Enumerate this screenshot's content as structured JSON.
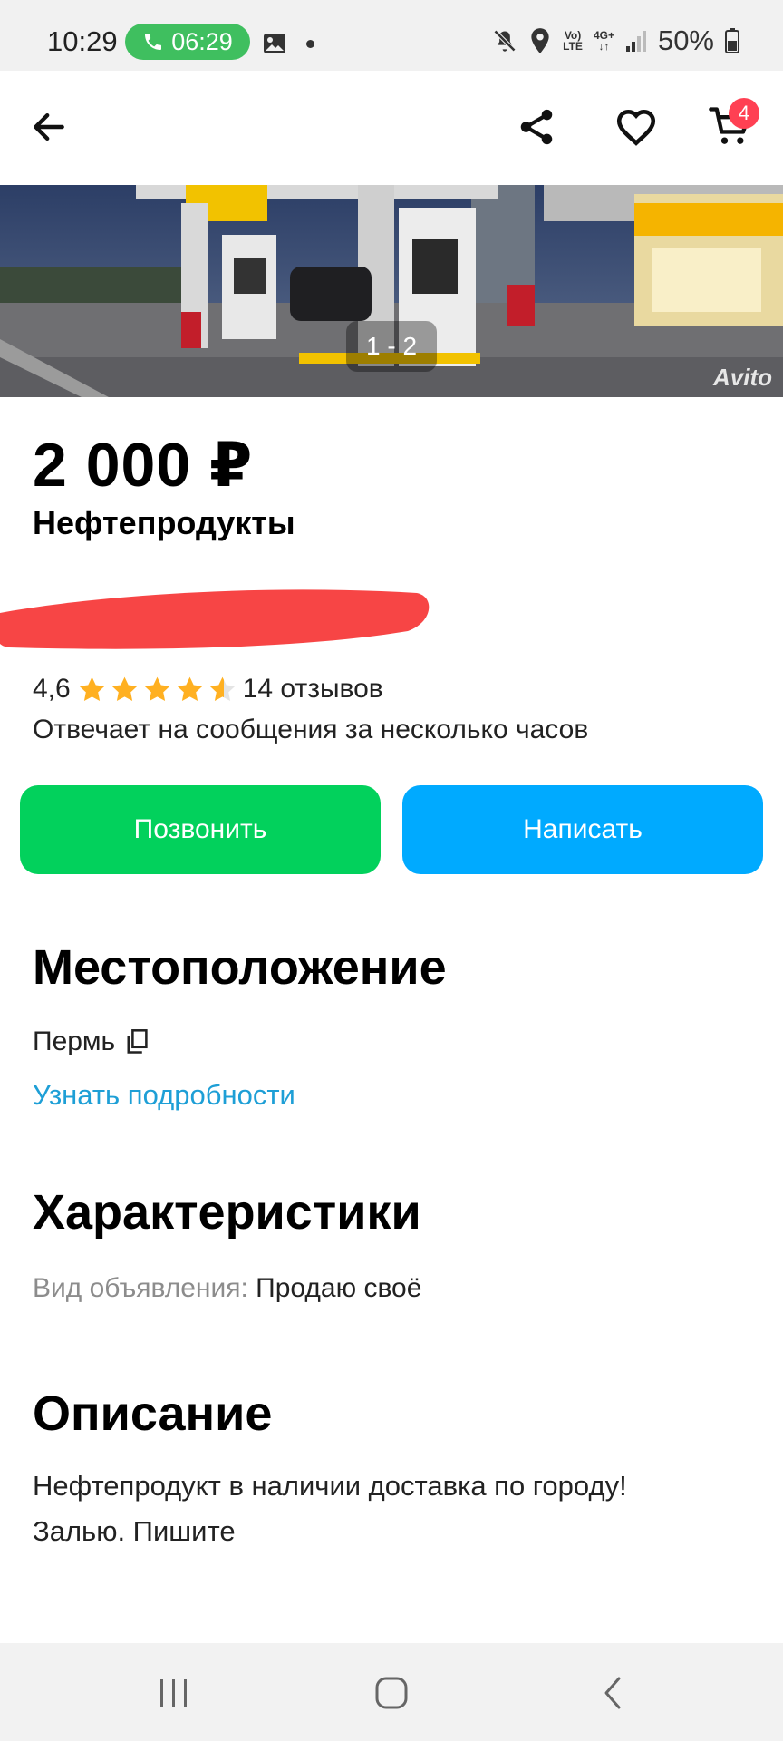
{
  "status_bar": {
    "time": "10:29",
    "call_timer": "06:29",
    "network_volte": "Vo)",
    "network_lte": "LTE",
    "network_4g": "4G+",
    "battery": "50%"
  },
  "app_bar": {
    "cart_count": "4"
  },
  "gallery": {
    "counter": "1 - 2",
    "watermark": "Avito"
  },
  "listing": {
    "price": "2 000 ₽",
    "title": "Нефтепродукты"
  },
  "seller": {
    "rating": "4,6",
    "rating_value": 4.6,
    "reviews": "14 отзывов",
    "reply_time": "Отвечает на сообщения за несколько часов"
  },
  "actions": {
    "call_label": "Позвонить",
    "write_label": "Написать"
  },
  "location": {
    "heading": "Местоположение",
    "city": "Пермь",
    "more_link": "Узнать подробности"
  },
  "characteristics": {
    "heading": "Характеристики",
    "items": [
      {
        "label": "Вид объявления: ",
        "value": "Продаю своё"
      }
    ]
  },
  "description": {
    "heading": "Описание",
    "lines": [
      "Нефтепродукт в наличии доставка по городу!",
      "Залью. Пишите"
    ]
  },
  "colors": {
    "call_button": "#02d15c",
    "write_button": "#00aaff",
    "link": "#1e9fd6",
    "star": "#ffb021",
    "badge": "#ff4053"
  }
}
